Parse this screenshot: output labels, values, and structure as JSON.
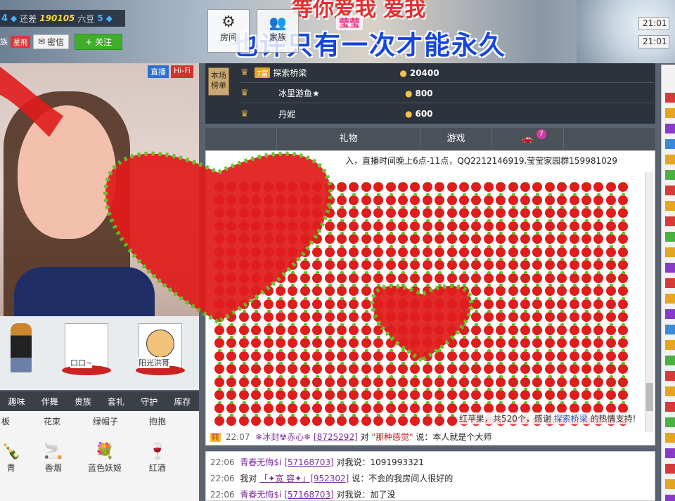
{
  "banner": {
    "top_text": "等你爱我 爱我",
    "tag": "莹莹",
    "title": "也许只有一次才能永久"
  },
  "streamer": {
    "level": "4",
    "gap_label": "还差",
    "gap_value": "190105",
    "gap_unit": "六豆",
    "next_level": "5",
    "clan": "族",
    "clan_badge": "星飛",
    "message_button": "密信",
    "follow_button": "+ 关注"
  },
  "toolbar": {
    "settings_label": "房间",
    "people_label": "家族",
    "times": [
      "21:01",
      "21:01"
    ]
  },
  "video": {
    "tags": [
      "直播",
      "Hi-Fi"
    ]
  },
  "guards": [
    {
      "label": ""
    },
    {
      "label": "口口~"
    },
    {
      "label": "阳光洪哥"
    }
  ],
  "gift_tabs": [
    "趣味",
    "伴舞",
    "贵族",
    "套礼",
    "守护",
    "库存"
  ],
  "gifts": [
    {
      "label": "板",
      "icon": "board-icon"
    },
    {
      "label": "花束",
      "icon": "flower-icon"
    },
    {
      "label": "绿帽子",
      "icon": "hat-icon"
    },
    {
      "label": "抱抱",
      "icon": "hug-icon"
    },
    {
      "label": "青",
      "icon": "bottle-icon"
    },
    {
      "label": "香烟",
      "icon": "cigarette-icon"
    },
    {
      "label": "蓝色妖姬",
      "icon": "rose-icon"
    },
    {
      "label": "红酒",
      "icon": "wine-icon"
    }
  ],
  "rank": {
    "badge": "本场榜单",
    "rows": [
      {
        "level": "7富",
        "name": "探索桥梁",
        "amount": "20400"
      },
      {
        "level": "",
        "name": "冰里游鱼★",
        "amount": "800"
      },
      {
        "level": "",
        "name": "丹妮",
        "amount": "600"
      }
    ]
  },
  "chat_tabs": [
    "",
    "礼物",
    "游戏",
    ""
  ],
  "car_count": "7",
  "announcement": "入，直播时间晚上6点-11点，QQ2212146919.莹莹家园群159981029",
  "apple_caption": {
    "prefix": "红苹果，共520个，感谢",
    "user": "探索桥梁",
    "suffix": "的热情支持!"
  },
  "chat": [
    {
      "time": "22:07",
      "tag": "转",
      "user": "❄冰封☢赤心❄",
      "id": "[8725292]",
      "mid": "对",
      "target": "\"那种感觉\"",
      "text": "说：本人就是个大师"
    }
  ],
  "chat2": [
    {
      "time": "22:06",
      "user": "青春无悔$i",
      "id": "[57168703]",
      "text": "对我说：1091993321"
    },
    {
      "time": "22:06",
      "user": "我对",
      "id": "「✦宽 容✦」[952302]",
      "text": "说：不会的我房间人很好的"
    },
    {
      "time": "22:06",
      "user": "青春无悔$i",
      "id": "[57168703]",
      "text": "对我说：加了没"
    }
  ],
  "colors": {
    "apple": "#e01c1c",
    "leaf": "#5ec21e",
    "accent": "#1646e0"
  }
}
